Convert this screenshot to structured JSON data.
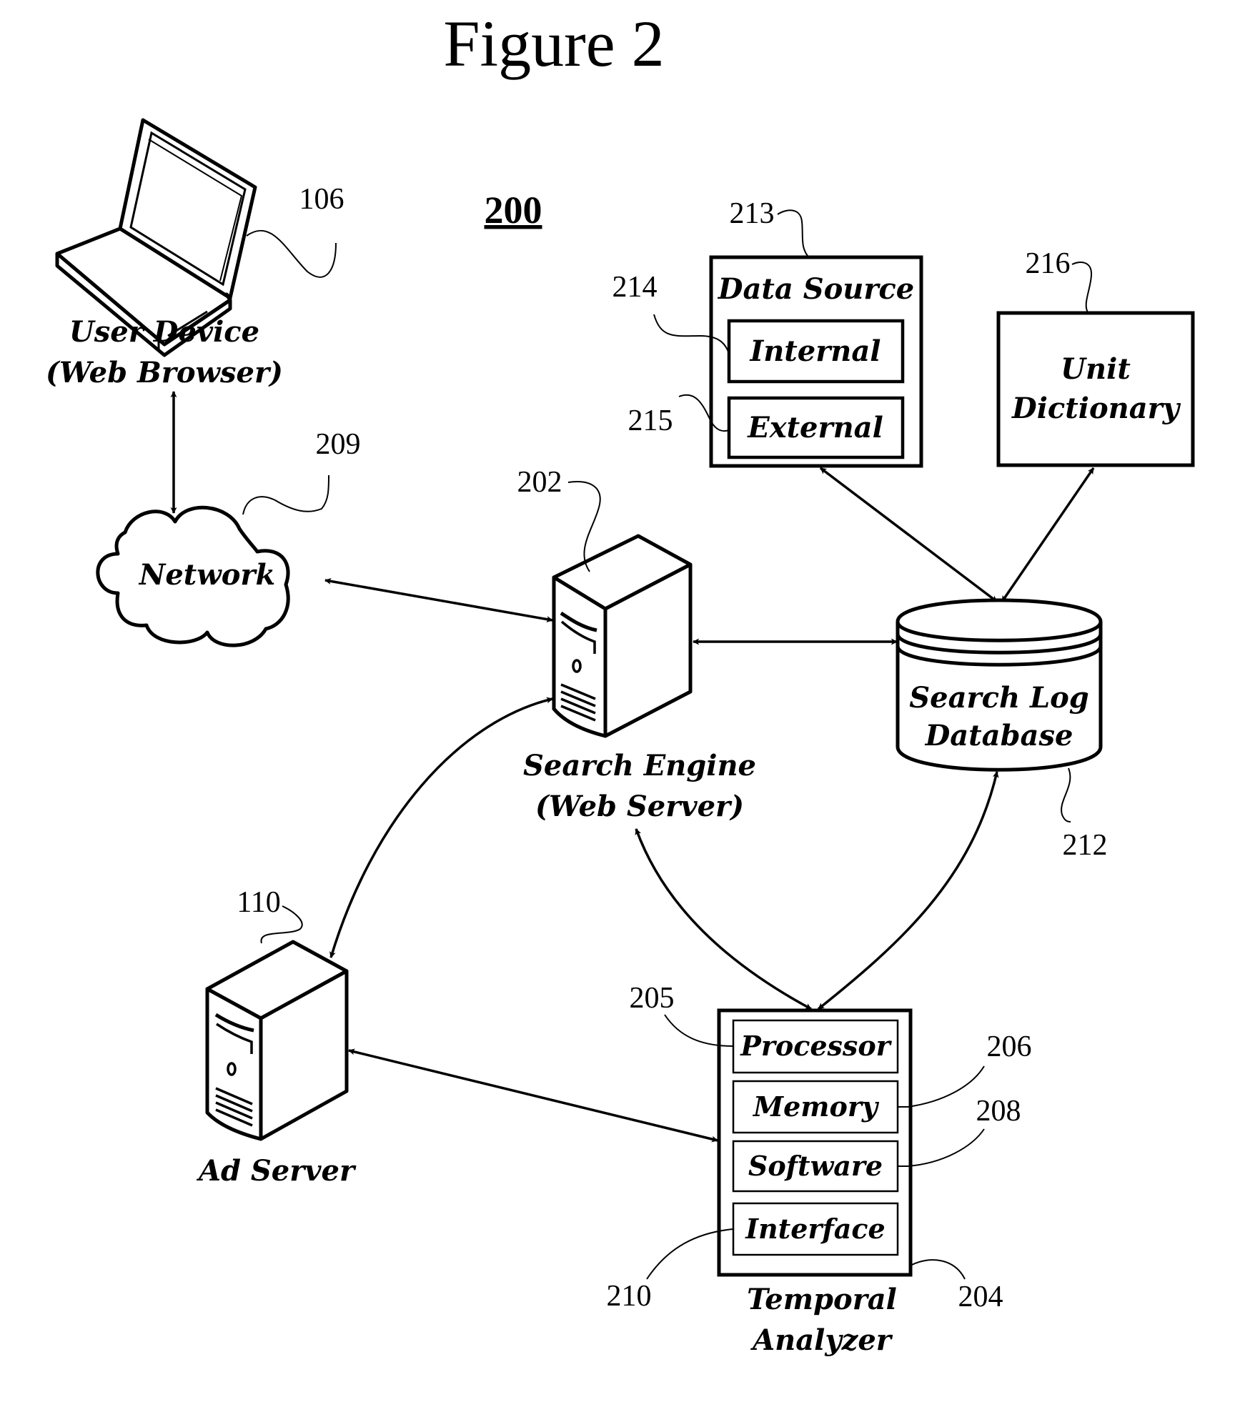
{
  "figure": {
    "title": "Figure 2",
    "system_ref": "200"
  },
  "nodes": {
    "user_device": {
      "ref": "106",
      "label_line1": "User Device",
      "label_line2": "(Web Browser)",
      "icon": "laptop-icon"
    },
    "network": {
      "ref": "209",
      "label": "Network",
      "icon": "cloud-icon"
    },
    "search_engine": {
      "ref": "202",
      "label_line1": "Search Engine",
      "label_line2": "(Web Server)",
      "icon": "server-tower-icon"
    },
    "data_source": {
      "ref": "213",
      "label": "Data Source",
      "children": [
        {
          "ref": "214",
          "label": "Internal"
        },
        {
          "ref": "215",
          "label": "External"
        }
      ]
    },
    "unit_dictionary": {
      "ref": "216",
      "label_line1": "Unit",
      "label_line2": "Dictionary"
    },
    "search_log_db": {
      "ref": "212",
      "label_line1": "Search Log",
      "label_line2": "Database",
      "icon": "database-cylinder-icon"
    },
    "ad_server": {
      "ref": "110",
      "label": "Ad Server",
      "icon": "server-tower-icon"
    },
    "temporal_analyzer": {
      "ref": "204",
      "label_line1": "Temporal",
      "label_line2": "Analyzer",
      "components": [
        {
          "ref": "205",
          "label": "Processor"
        },
        {
          "ref": "206",
          "label": "Memory"
        },
        {
          "ref": "208",
          "label": "Software"
        },
        {
          "ref": "210",
          "label": "Interface"
        }
      ]
    }
  },
  "connections": [
    {
      "from": "User Device",
      "to": "Network",
      "direction": "bidirectional"
    },
    {
      "from": "Network",
      "to": "Search Engine",
      "direction": "bidirectional"
    },
    {
      "from": "Search Engine",
      "to": "Search Log Database",
      "direction": "bidirectional"
    },
    {
      "from": "Data Source",
      "to": "Search Log Database",
      "direction": "bidirectional"
    },
    {
      "from": "Unit Dictionary",
      "to": "Search Log Database",
      "direction": "bidirectional"
    },
    {
      "from": "Search Engine",
      "to": "Ad Server",
      "direction": "bidirectional"
    },
    {
      "from": "Search Engine",
      "to": "Temporal Analyzer",
      "direction": "bidirectional"
    },
    {
      "from": "Search Log Database",
      "to": "Temporal Analyzer",
      "direction": "bidirectional"
    },
    {
      "from": "Ad Server",
      "to": "Temporal Analyzer",
      "direction": "bidirectional"
    }
  ]
}
